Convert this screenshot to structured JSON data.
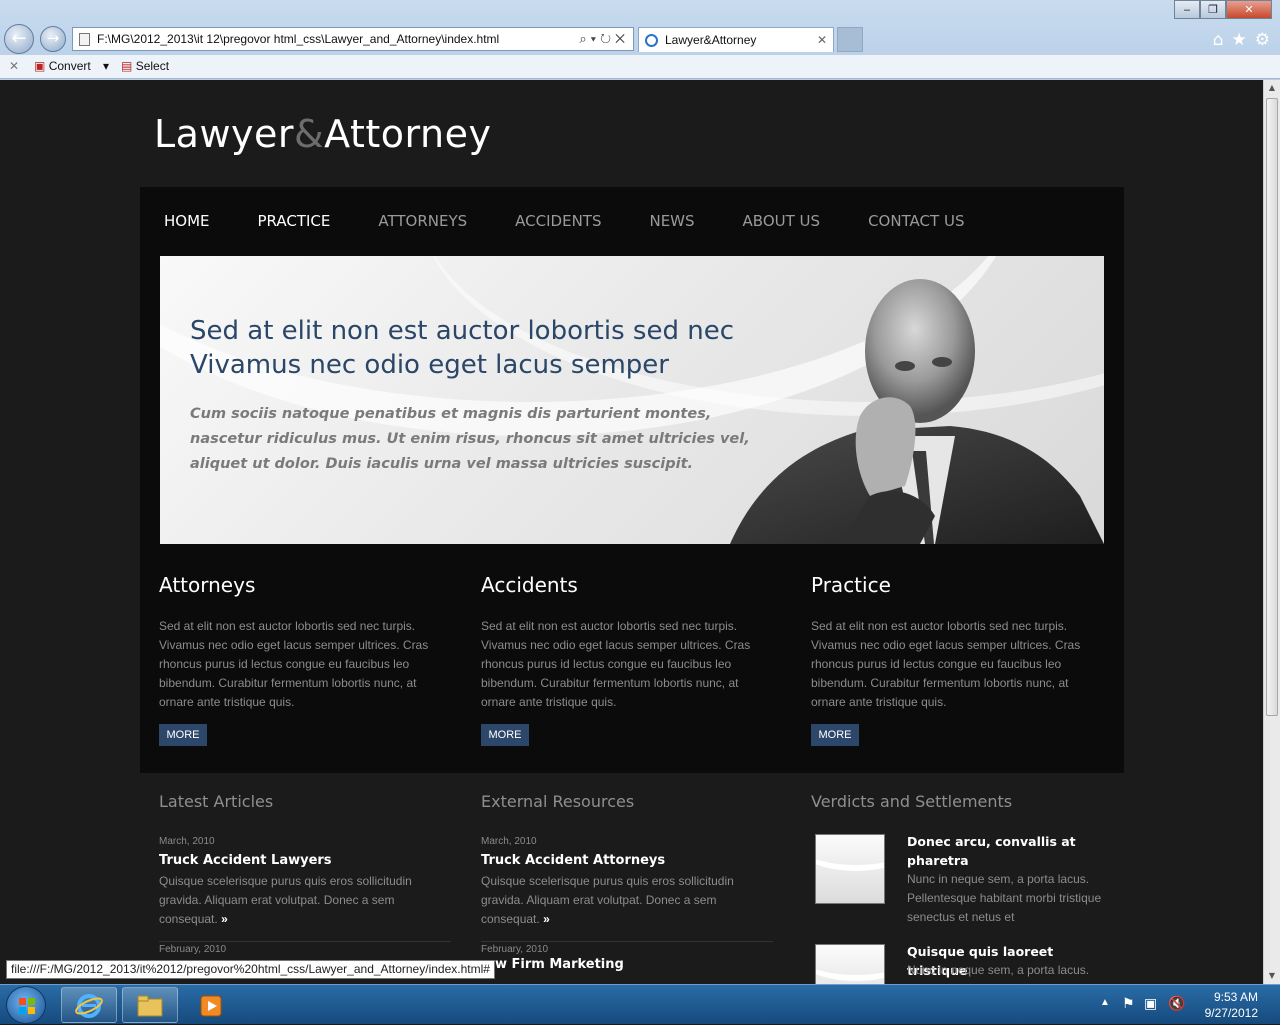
{
  "browser": {
    "address": "F:\\MG\\2012_2013\\it 12\\pregovor html_css\\Lawyer_and_Attorney\\index.html",
    "tab_title": "Lawyer&Attorney",
    "cmd_convert": "Convert",
    "cmd_select": "Select",
    "status_url": "file:///F:/MG/2012_2013/it%2012/pregovor%20html_css/Lawyer_and_Attorney/index.html#"
  },
  "site": {
    "logo_part1": "Lawyer",
    "logo_amp": "&",
    "logo_part2": "Attorney",
    "nav": [
      "HOME",
      "PRACTICE",
      "ATTORNEYS",
      "ACCIDENTS",
      "NEWS",
      "ABOUT US",
      "CONTACT US"
    ],
    "banner": {
      "heading_line1": "Sed at elit non est auctor lobortis sed nec",
      "heading_line2": "Vivamus nec odio eget lacus semper",
      "text": "Cum sociis natoque penatibus et magnis dis parturient montes, nascetur ridiculus mus. Ut enim risus, rhoncus sit amet ultricies vel, aliquet ut dolor. Duis iaculis urna vel massa ultricies suscipit."
    },
    "columns": [
      {
        "title": "Attorneys",
        "text": "Sed at elit non est auctor lobortis sed nec turpis. Vivamus nec odio eget lacus semper ultrices. Cras rhoncus purus id lectus congue eu faucibus leo bibendum. Curabitur fermentum lobortis nunc, at ornare ante tristique quis.",
        "button": "MORE"
      },
      {
        "title": "Accidents",
        "text": "Sed at elit non est auctor lobortis sed nec turpis. Vivamus nec odio eget lacus semper ultrices. Cras rhoncus purus id lectus congue eu faucibus leo bibendum. Curabitur fermentum lobortis nunc, at ornare ante tristique quis.",
        "button": "MORE"
      },
      {
        "title": "Practice",
        "text": "Sed at elit non est auctor lobortis sed nec turpis. Vivamus nec odio eget lacus semper ultrices. Cras rhoncus purus id lectus congue eu faucibus leo bibendum. Curabitur fermentum lobortis nunc, at ornare ante tristique quis.",
        "button": "MORE"
      }
    ],
    "latest_articles": {
      "heading": "Latest Articles",
      "items": [
        {
          "date": "March, 2010",
          "title": "Truck Accident Lawyers",
          "text": "Quisque scelerisque purus quis eros sollicitudin gravida. Aliquam erat volutpat. Donec a sem consequat.",
          "arrow": "»"
        },
        {
          "date": "February, 2010",
          "title": "",
          "text": "",
          "arrow": ""
        }
      ]
    },
    "external_resources": {
      "heading": "External Resources",
      "items": [
        {
          "date": "March, 2010",
          "title": "Truck Accident Attorneys",
          "text": "Quisque scelerisque purus quis eros sollicitudin gravida. Aliquam erat volutpat. Donec a sem consequat.",
          "arrow": "»"
        },
        {
          "date": "February, 2010",
          "title": "w Firm Marketing",
          "text": "",
          "arrow": ""
        }
      ]
    },
    "verdicts": {
      "heading": "Verdicts and Settlements",
      "items": [
        {
          "title": "Donec arcu, convallis at pharetra",
          "text": "Nunc in neque sem, a porta lacus. Pellentesque habitant morbi tristique senectus et netus et"
        },
        {
          "title": "Quisque quis laoreet tristique",
          "text": "Nunc in neque sem, a porta lacus."
        }
      ]
    }
  },
  "taskbar": {
    "time": "9:53 AM",
    "date": "9/27/2012"
  }
}
